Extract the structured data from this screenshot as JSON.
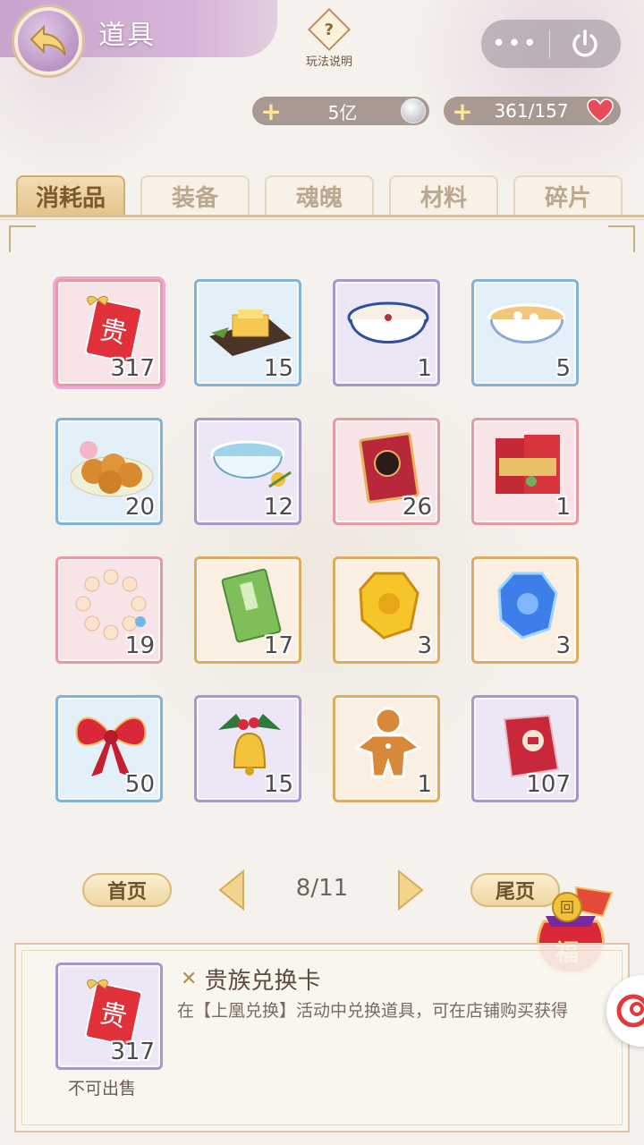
{
  "header": {
    "title": "道具",
    "help_label": "玩法说明",
    "help_symbol": "?",
    "more_label": "•••"
  },
  "currency": {
    "silver": "5亿",
    "hearts": "361/157",
    "plus": "+"
  },
  "tabs": [
    {
      "label": "消耗品",
      "active": true
    },
    {
      "label": "装备",
      "active": false
    },
    {
      "label": "魂魄",
      "active": false
    },
    {
      "label": "材料",
      "active": false
    },
    {
      "label": "碎片",
      "active": false
    }
  ],
  "items": [
    {
      "icon": "red-card-icon",
      "frame": "pink",
      "count": "317",
      "selected": true
    },
    {
      "icon": "cake-platter-icon",
      "frame": "blue",
      "count": "15"
    },
    {
      "icon": "porcelain-bowl-icon",
      "frame": "purple",
      "count": "1"
    },
    {
      "icon": "soup-bowl-icon",
      "frame": "blue",
      "count": "5"
    },
    {
      "icon": "mooncakes-icon",
      "frame": "blue",
      "count": "20"
    },
    {
      "icon": "tea-bowl-icon",
      "frame": "purple",
      "count": "12"
    },
    {
      "icon": "red-book-icon",
      "frame": "pink",
      "count": "26"
    },
    {
      "icon": "red-envelopes-icon",
      "frame": "pink",
      "count": "1"
    },
    {
      "icon": "pearl-bracelet-icon",
      "frame": "pink",
      "count": "19"
    },
    {
      "icon": "green-book-icon",
      "frame": "orange",
      "count": "17"
    },
    {
      "icon": "gold-gem-icon",
      "frame": "orange",
      "count": "3"
    },
    {
      "icon": "blue-gem-icon",
      "frame": "orange",
      "count": "3"
    },
    {
      "icon": "red-bow-icon",
      "frame": "blue",
      "count": "50"
    },
    {
      "icon": "christmas-bell-icon",
      "frame": "purple",
      "count": "15"
    },
    {
      "icon": "gingerbread-icon",
      "frame": "orange",
      "count": "1"
    },
    {
      "icon": "red-packet-icon",
      "frame": "purple",
      "count": "107"
    }
  ],
  "pagination": {
    "first_label": "首页",
    "last_label": "尾页",
    "page": "8/11"
  },
  "detail": {
    "name": "贵族兑换卡",
    "name_mark": "✕",
    "description": "在【上凰兑换】活动中兑换道具，可在店铺购买获得",
    "count": "317",
    "status": "不可出售",
    "card_char": "贵"
  },
  "fortune": {
    "char": "福",
    "coin_char": "回"
  },
  "colors": {
    "accent_purple": "#c8a4cc",
    "tab_active": "#e4c48d",
    "frame_pink": "#e89aa3",
    "frame_blue": "#7fb3d9",
    "frame_purple": "#a996cd",
    "frame_orange": "#e2aa5c"
  }
}
